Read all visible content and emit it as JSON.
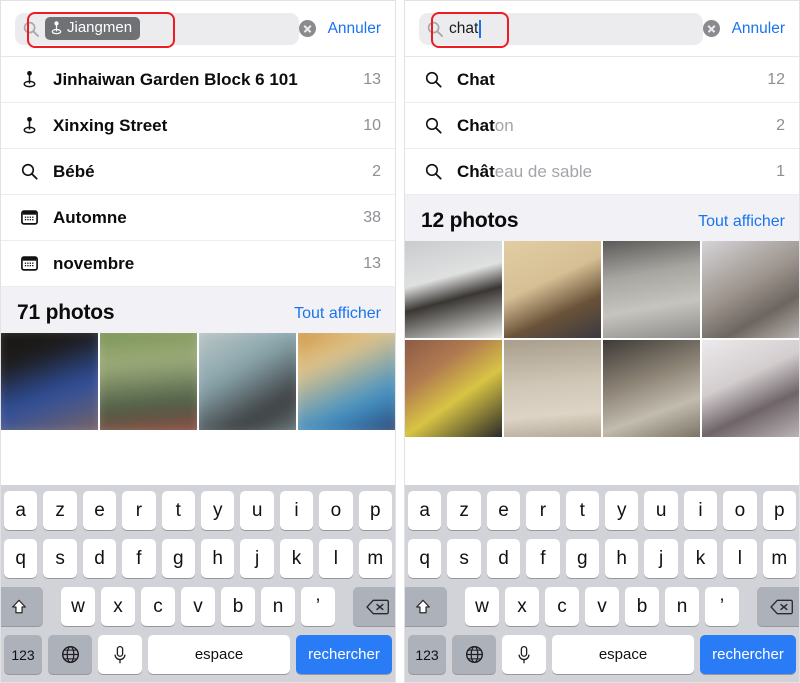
{
  "panels": [
    {
      "id": "left",
      "search": {
        "icon": "search-icon",
        "token": {
          "icon": "location-pin-icon",
          "label": "Jiangmen"
        },
        "typed": "",
        "has_caret": false,
        "clear_icon": "clear-circle-icon",
        "cancel_label": "Annuler",
        "highlighted": true
      },
      "suggestions": [
        {
          "icon": "location-pin-icon",
          "match": "Jinhaiwan Garden Block 6 101",
          "rest": "",
          "count": "13"
        },
        {
          "icon": "location-pin-icon",
          "match": "Xinxing Street",
          "rest": "",
          "count": "10"
        },
        {
          "icon": "search-icon",
          "match": "Bébé",
          "rest": "",
          "count": "2"
        },
        {
          "icon": "calendar-icon",
          "match": "Automne",
          "rest": "",
          "count": "38"
        },
        {
          "icon": "calendar-icon",
          "match": "novembre",
          "rest": "",
          "count": "13"
        }
      ],
      "photos": {
        "title": "71 photos",
        "see_all_label": "Tout afficher",
        "blurred": true,
        "thumbnails": [
          {
            "name": "photo-thumb-1",
            "colors": [
              "#181615",
              "#2f4f9c",
              "#8a6a58"
            ]
          },
          {
            "name": "photo-thumb-2",
            "colors": [
              "#5c7a3a",
              "#a8b07a",
              "#3e4230"
            ]
          },
          {
            "name": "photo-thumb-3",
            "colors": [
              "#8aa6ad",
              "#3a3c3e",
              "#c9cfcd"
            ]
          },
          {
            "name": "photo-thumb-4",
            "colors": [
              "#c8862e",
              "#3f8fc4",
              "#e0c48a"
            ]
          }
        ]
      },
      "keyboard_id": "keyboard-left"
    },
    {
      "id": "right",
      "search": {
        "icon": "search-icon",
        "token": null,
        "typed": "chat",
        "has_caret": true,
        "clear_icon": "clear-circle-icon",
        "cancel_label": "Annuler",
        "highlighted": true
      },
      "suggestions": [
        {
          "icon": "search-icon",
          "match": "Chat",
          "rest": "",
          "count": "12"
        },
        {
          "icon": "search-icon",
          "match": "Chat",
          "rest": "on",
          "count": "2"
        },
        {
          "icon": "search-icon",
          "match": "Chât",
          "rest": "eau de sable",
          "count": "1"
        }
      ],
      "photos": {
        "title": "12 photos",
        "see_all_label": "Tout afficher",
        "blurred": false,
        "thumbnails": [
          {
            "name": "photo-thumb-cat-1",
            "colors": [
              "#b9bcbd",
              "#30302e",
              "#e6e7e4"
            ]
          },
          {
            "name": "photo-thumb-cat-2",
            "colors": [
              "#dcc79b",
              "#6a5239",
              "#3b3a40"
            ]
          },
          {
            "name": "photo-thumb-cat-3",
            "colors": [
              "#9a9a97",
              "#2e2b2a",
              "#c3c2bd"
            ]
          },
          {
            "name": "photo-thumb-cat-4",
            "colors": [
              "#cfcdd2",
              "#6d655f",
              "#a29a93"
            ]
          },
          {
            "name": "photo-thumb-cat-5",
            "colors": [
              "#8d5b46",
              "#d8c444",
              "#2b2a28"
            ]
          },
          {
            "name": "photo-thumb-cat-6",
            "colors": [
              "#b6ab9a",
              "#d8cfc0",
              "#645a4c"
            ]
          },
          {
            "name": "photo-thumb-cat-7",
            "colors": [
              "#8b8274",
              "#2c2926",
              "#cdc6b8"
            ]
          },
          {
            "name": "photo-thumb-cat-8",
            "colors": [
              "#e6e3e6",
              "#5d5458",
              "#b5aeb0"
            ]
          }
        ]
      },
      "keyboard_id": "keyboard-right"
    }
  ],
  "keyboard": {
    "row1": [
      "a",
      "z",
      "e",
      "r",
      "t",
      "y",
      "u",
      "i",
      "o",
      "p"
    ],
    "row2": [
      "q",
      "s",
      "d",
      "f",
      "g",
      "h",
      "j",
      "k",
      "l",
      "m"
    ],
    "row3_letters": [
      "w",
      "x",
      "c",
      "v",
      "b",
      "n",
      "’"
    ],
    "shift_icon": "shift-icon",
    "backspace_icon": "backspace-icon",
    "numbers_label": "123",
    "globe_icon": "globe-icon",
    "mic_icon": "microphone-icon",
    "space_label": "espace",
    "search_key_label": "rechercher"
  },
  "colors": {
    "accent_blue": "#1a74f0",
    "key_blue": "#2a7cf6",
    "annotation_red": "#ee1b24",
    "keyboard_bg": "#d1d3d9",
    "section_bg": "#f2f2f6",
    "token_gray": "#6f7175",
    "count_gray": "#8e8e93",
    "suggestion_rest_gray": "#a4a4aa"
  }
}
